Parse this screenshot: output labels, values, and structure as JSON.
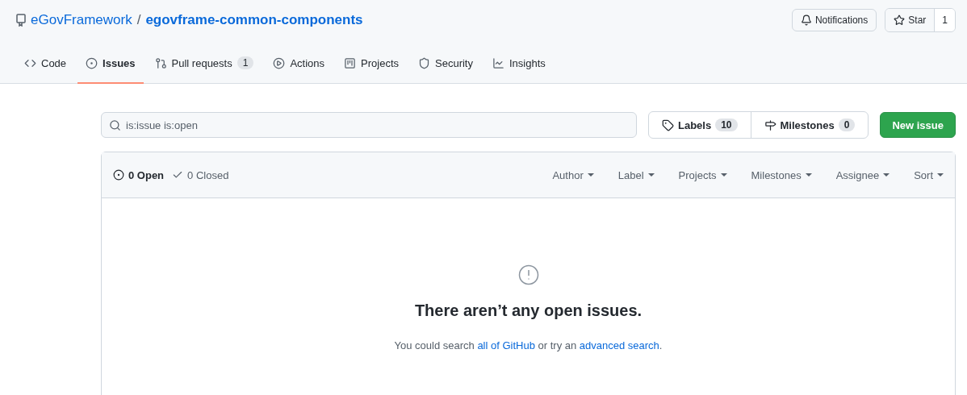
{
  "repo": {
    "owner": "eGovFramework",
    "separator": "/",
    "name": "egovframe-common-components"
  },
  "header_actions": {
    "notifications": "Notifications",
    "star": "Star",
    "star_count": "1"
  },
  "tabs": [
    {
      "label": "Code",
      "selected": false
    },
    {
      "label": "Issues",
      "selected": true
    },
    {
      "label": "Pull requests",
      "selected": false,
      "count": "1"
    },
    {
      "label": "Actions",
      "selected": false
    },
    {
      "label": "Projects",
      "selected": false
    },
    {
      "label": "Security",
      "selected": false
    },
    {
      "label": "Insights",
      "selected": false
    }
  ],
  "search": {
    "value": "is:issue is:open"
  },
  "labels": {
    "label": "Labels",
    "count": "10"
  },
  "milestones": {
    "label": "Milestones",
    "count": "0"
  },
  "new_issue": "New issue",
  "states": [
    {
      "label": "0 Open",
      "selected": true
    },
    {
      "label": "0 Closed",
      "selected": false
    }
  ],
  "filters": [
    "Author",
    "Label",
    "Projects",
    "Milestones",
    "Assignee",
    "Sort"
  ],
  "empty": {
    "title": "There aren’t any open issues.",
    "message": [
      {
        "kind": "text",
        "text": "You could search "
      },
      {
        "kind": "link",
        "text": "all of GitHub"
      },
      {
        "kind": "text",
        "text": " or try an "
      },
      {
        "kind": "link",
        "text": "advanced search"
      },
      {
        "kind": "text",
        "text": "."
      }
    ]
  }
}
